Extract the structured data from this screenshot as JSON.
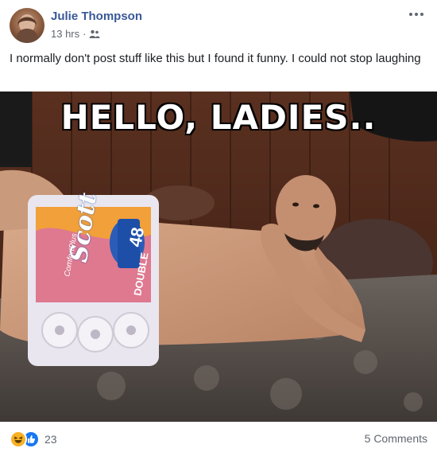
{
  "post": {
    "author": "Julie Thompson",
    "time": "13 hrs",
    "separator": "·",
    "privacy_icon": "friends-icon",
    "more_icon": "more-options-icon",
    "text": "I normally don't post stuff like this but I found it funny. I could not stop laughing"
  },
  "photo": {
    "caption": "HELLO, LADIES..",
    "package_brand": "Scott",
    "package_count": "48",
    "package_type": "DOUBLE",
    "package_line": "ComfortPlus"
  },
  "footer": {
    "reaction_icons": [
      "haha-icon",
      "like-icon"
    ],
    "reaction_count": "23",
    "comments": "5 Comments"
  },
  "colors": {
    "author_link": "#385898",
    "meta_text": "#616770",
    "like_blue": "#1877f2",
    "haha_yellow": "#f7b125"
  }
}
